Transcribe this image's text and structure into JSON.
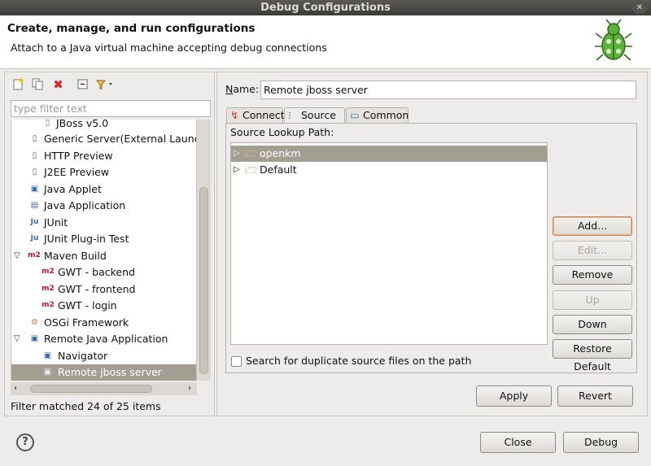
{
  "window": {
    "title": "Debug Configurations"
  },
  "header": {
    "title": "Create, manage, and run configurations",
    "subtitle": "Attach to a Java virtual machine accepting debug connections"
  },
  "left": {
    "filter_placeholder": "type filter text",
    "tree": [
      {
        "label": "JBoss v5.0",
        "level": 2,
        "icon": "server-icon"
      },
      {
        "label": "Generic Server(External Launch)",
        "level": 1,
        "icon": "server-icon"
      },
      {
        "label": "HTTP Preview",
        "level": 1,
        "icon": "server-icon"
      },
      {
        "label": "J2EE Preview",
        "level": 1,
        "icon": "server-icon"
      },
      {
        "label": "Java Applet",
        "level": 1,
        "icon": "applet-icon"
      },
      {
        "label": "Java Application",
        "level": 1,
        "icon": "java-app-icon"
      },
      {
        "label": "JUnit",
        "level": 1,
        "icon": "junit-icon"
      },
      {
        "label": "JUnit Plug-in Test",
        "level": 1,
        "icon": "junit-plugin-icon"
      },
      {
        "label": "Maven Build",
        "level": 0,
        "icon": "maven-icon",
        "expanded": true
      },
      {
        "label": "GWT - backend",
        "level": 2,
        "icon": "maven-icon"
      },
      {
        "label": "GWT - frontend",
        "level": 2,
        "icon": "maven-icon"
      },
      {
        "label": "GWT - login",
        "level": 2,
        "icon": "maven-icon"
      },
      {
        "label": "OSGi Framework",
        "level": 1,
        "icon": "osgi-icon"
      },
      {
        "label": "Remote Java Application",
        "level": 0,
        "icon": "remote-java-icon",
        "expanded": true
      },
      {
        "label": "Navigator",
        "level": 2,
        "icon": "remote-java-icon"
      },
      {
        "label": "Remote jboss server",
        "level": 2,
        "icon": "remote-java-icon",
        "selected": true
      }
    ],
    "status": "Filter matched 24 of 25 items"
  },
  "right": {
    "name_label": "Name:",
    "name_value": "Remote jboss server",
    "tabs": [
      {
        "label": "Connect"
      },
      {
        "label": "Source",
        "active": true
      },
      {
        "label": "Common"
      }
    ],
    "source_label": "Source Lookup Path:",
    "source_items": [
      {
        "label": "openkm",
        "selected": true
      },
      {
        "label": "Default"
      }
    ],
    "buttons": {
      "add": "Add...",
      "edit": "Edit...",
      "remove": "Remove",
      "up": "Up",
      "down": "Down",
      "restore": "Restore Default"
    },
    "search_duplicates": "Search for duplicate source files on the path",
    "apply": "Apply",
    "revert": "Revert"
  },
  "footer": {
    "close": "Close",
    "debug": "Debug"
  },
  "colors": {
    "selection": "#a39e92",
    "maven": "#c8102e"
  }
}
